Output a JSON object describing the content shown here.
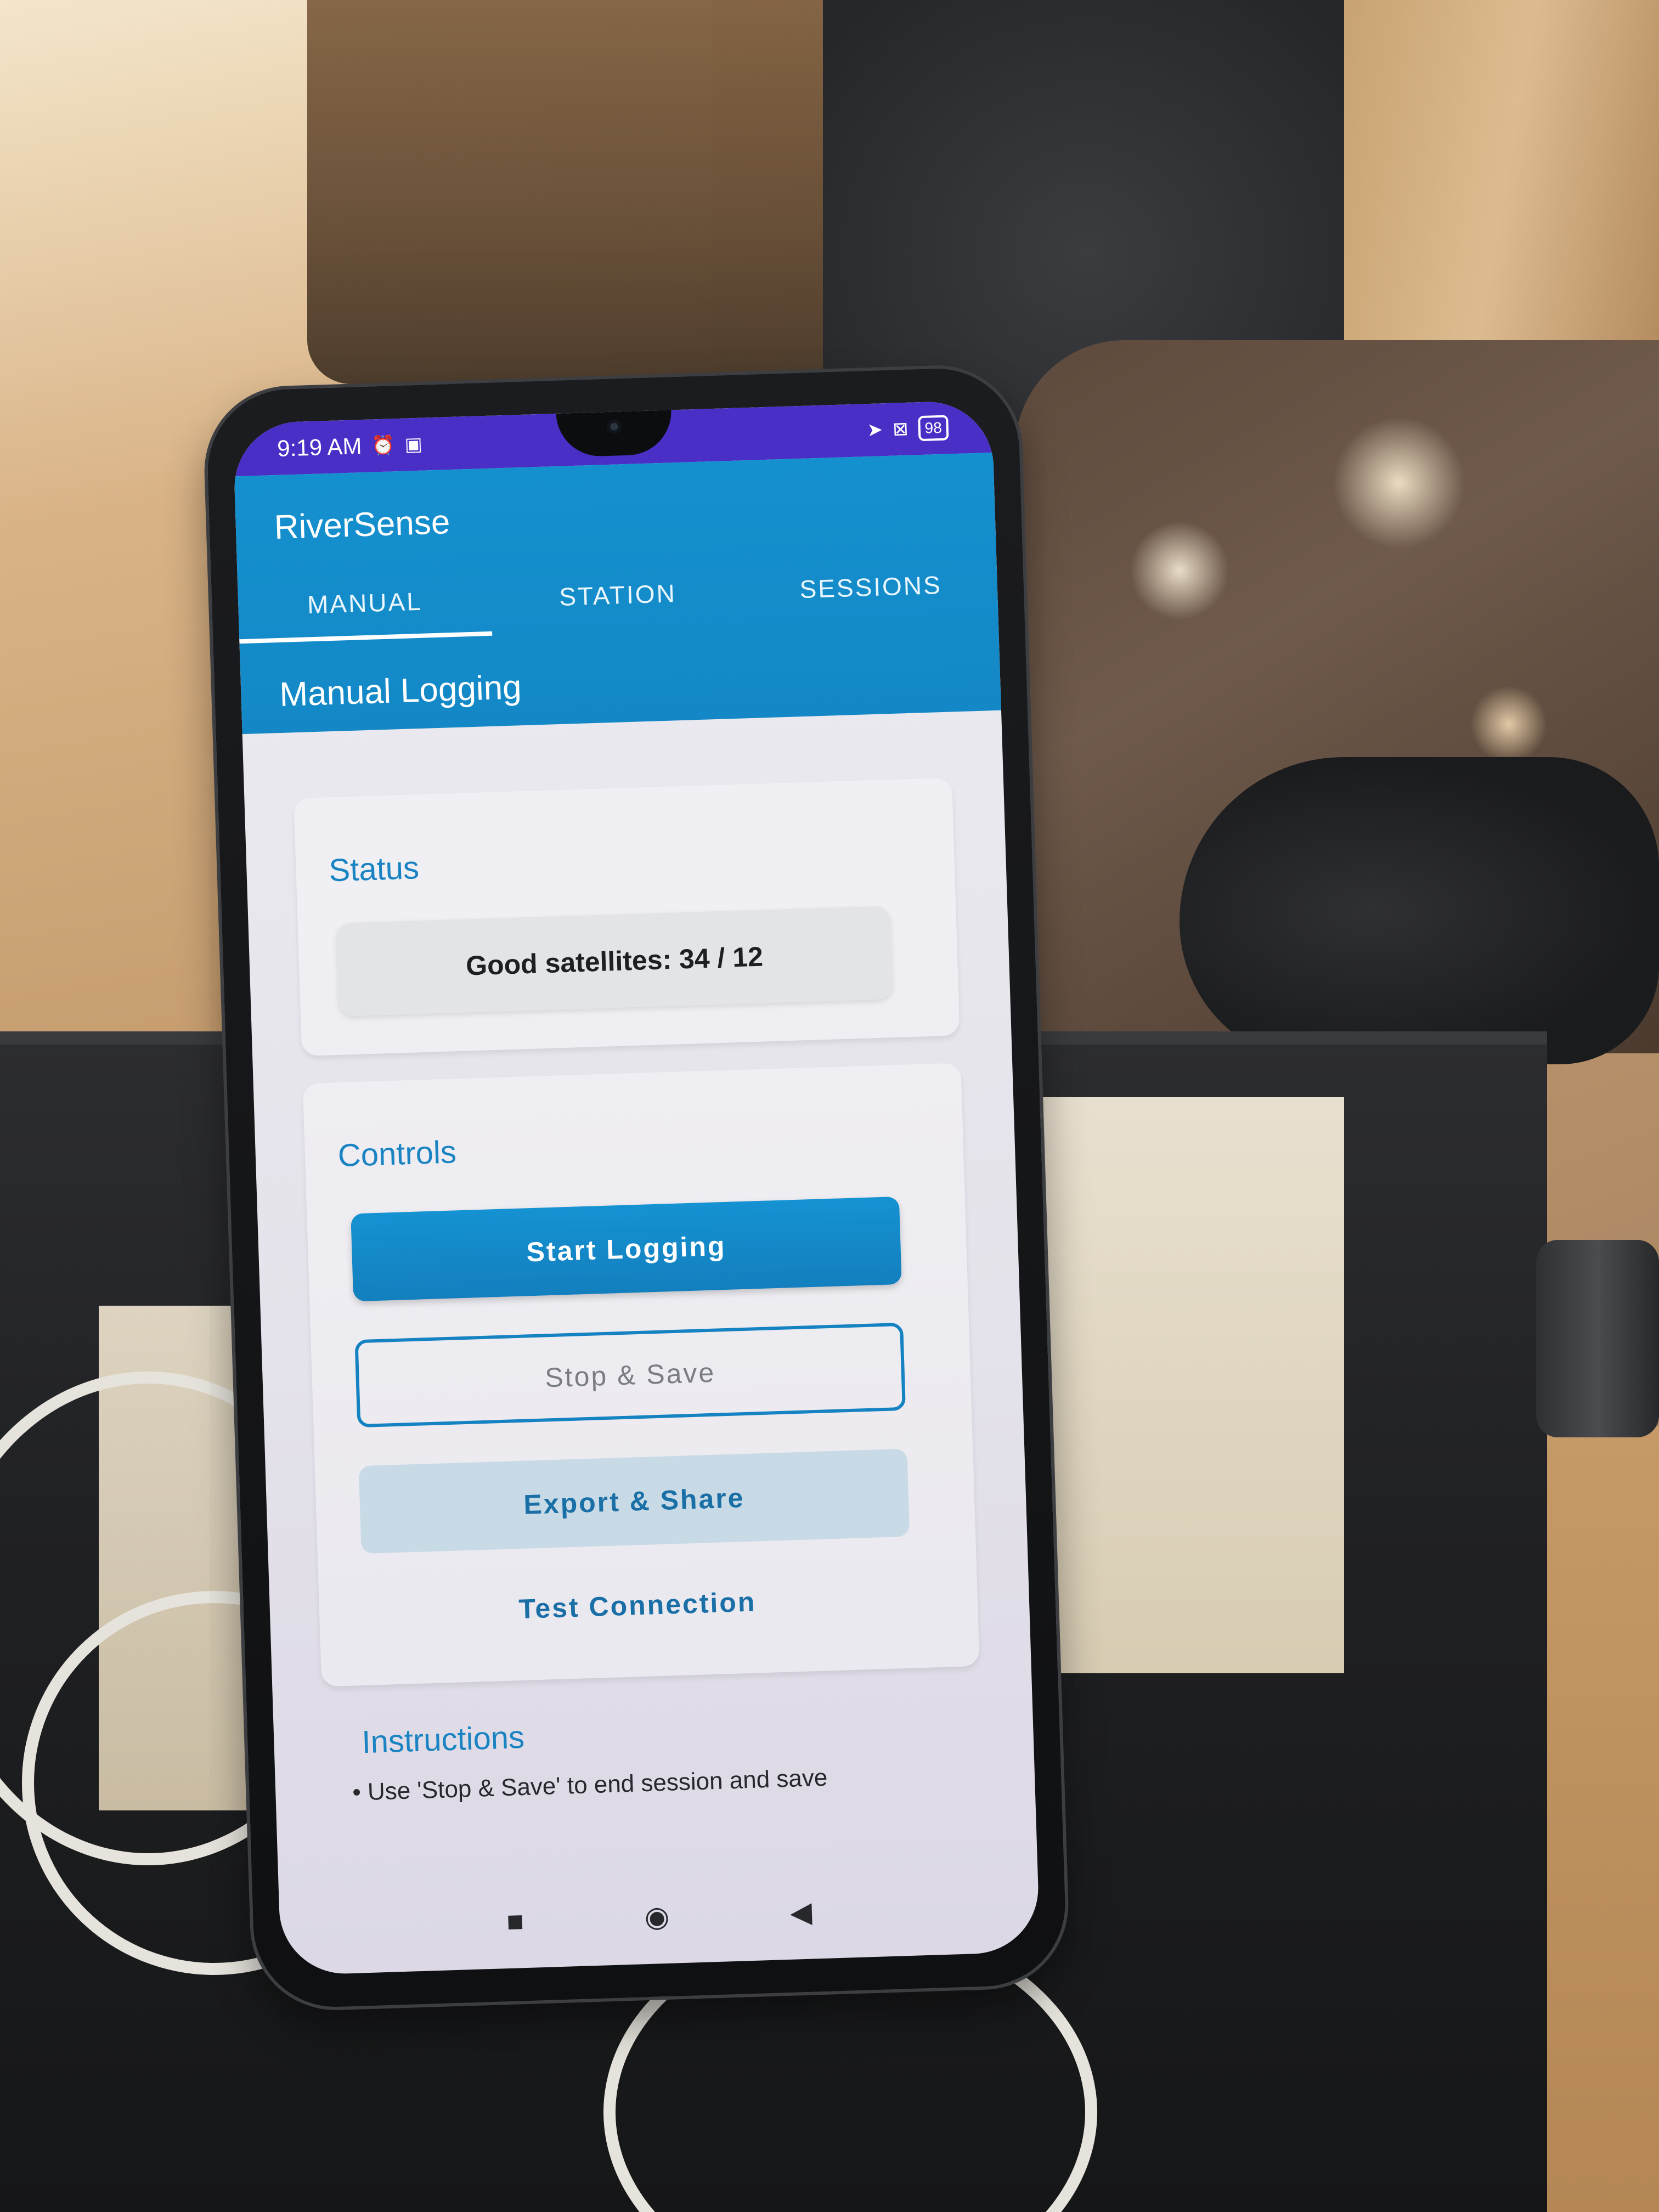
{
  "status_bar": {
    "time": "9:19 AM",
    "left_icons": [
      "alarm-off-icon",
      "mi-icon"
    ],
    "right_icons": [
      "location-arrow-icon",
      "close-box-icon"
    ],
    "battery": "98"
  },
  "app": {
    "title": "RiverSense",
    "tabs": [
      {
        "label": "MANUAL",
        "active": true
      },
      {
        "label": "STATION",
        "active": false
      },
      {
        "label": "SESSIONS",
        "active": false
      }
    ],
    "section_title": "Manual Logging"
  },
  "status_card": {
    "title": "Status",
    "value": "Good satellites: 34 / 12"
  },
  "controls_card": {
    "title": "Controls",
    "start_label": "Start Logging",
    "stop_label": "Stop & Save",
    "export_label": "Export & Share",
    "test_label": "Test Connection"
  },
  "instructions": {
    "title": "Instructions",
    "items": [
      "• Use 'Stop & Save' to end session and save"
    ]
  },
  "nav_bar": {
    "icons": [
      "recents-square-icon",
      "home-circle-icon",
      "back-triangle-icon"
    ]
  },
  "colors": {
    "status_bar": "#4a2fc6",
    "app_bar": "#1590cf",
    "accent": "#1a84c2"
  }
}
